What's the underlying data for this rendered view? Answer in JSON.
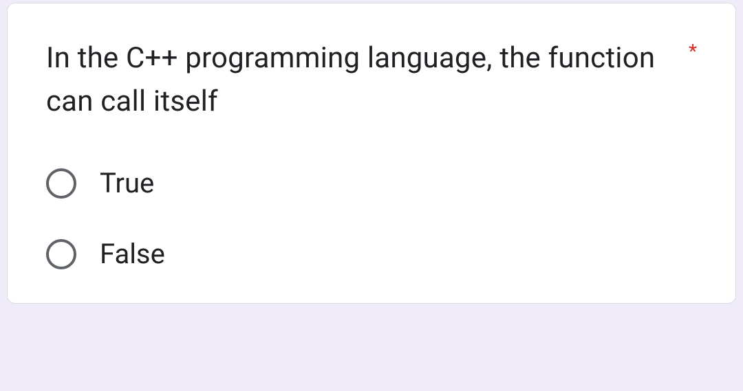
{
  "question": {
    "text": "In the C++ programming language, the function can call itself",
    "required_mark": "*",
    "options": [
      {
        "label": "True"
      },
      {
        "label": "False"
      }
    ]
  }
}
